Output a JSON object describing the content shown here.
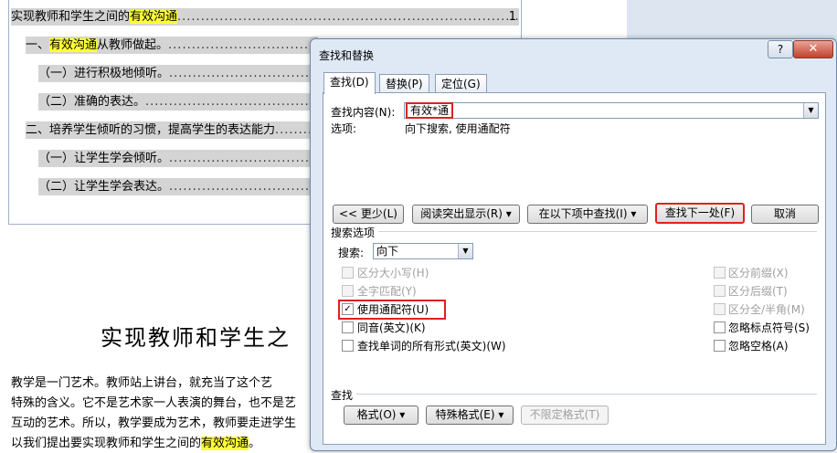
{
  "document": {
    "toc": [
      {
        "before": "实现教师和学生之间的",
        "highlight": "有效沟通",
        "after": "",
        "dots": "..................................................................................................................",
        "page": "1"
      },
      {
        "before": "一、",
        "highlight": "有效沟通",
        "after": "从教师做起。",
        "dots": "............................................................................."
      },
      {
        "before": "（一）进行积极地倾听。",
        "highlight": "",
        "after": "",
        "dots": "............................................................................."
      },
      {
        "before": "（二）准确的表达。",
        "highlight": "",
        "after": "",
        "dots": "..................................................................................."
      },
      {
        "before": "二、培养学生倾听的习惯，提高学生的表达能力",
        "highlight": "",
        "after": "",
        "dots": "..............."
      },
      {
        "before": "（一）让学生学会倾听。",
        "highlight": "",
        "after": "",
        "dots": "............................................................................."
      },
      {
        "before": "（二）让学生学会表达。",
        "highlight": "",
        "after": "",
        "dots": "............................................................................."
      }
    ],
    "title": "实现教师和学生之",
    "paragraph": [
      {
        "text": "    教学是一门艺术。教师站上讲台，就充当了这个艺",
        "highlight": ""
      },
      {
        "text": "特殊的含义。它不是艺术家一人表演的舞台，也不是艺",
        "highlight": ""
      },
      {
        "text": "互动的艺术。所以，教学要成为艺术，教师要走进学生",
        "highlight": ""
      },
      {
        "text": "以我们提出要实现教师和学生之间的",
        "highlight": "有效沟通",
        "tail": "。"
      }
    ]
  },
  "dialog": {
    "title": "查找和替换",
    "help_label": "?",
    "close_label": "✕",
    "tabs": [
      "查找(D)",
      "替换(P)",
      "定位(G)"
    ],
    "find_label": "查找内容(N):",
    "find_value": "有效*通",
    "options_label": "选项:",
    "options_value": "向下搜索, 使用通配符",
    "buttons": {
      "less": "<< 更少(L)",
      "reading_highlight": "阅读突出显示(R) ▾",
      "find_in": "在以下项中查找(I) ▾",
      "find_next": "查找下一处(F)",
      "cancel": "取消"
    },
    "search_options_title": "搜索选项",
    "search_label": "搜索:",
    "search_direction": "向下",
    "checkboxes_left": [
      {
        "label": "区分大小写(H)",
        "checked": false,
        "enabled": false
      },
      {
        "label": "全字匹配(Y)",
        "checked": false,
        "enabled": false
      },
      {
        "label": "使用通配符(U)",
        "checked": true,
        "enabled": true
      },
      {
        "label": "同音(英文)(K)",
        "checked": false,
        "enabled": true
      },
      {
        "label": "查找单词的所有形式(英文)(W)",
        "checked": false,
        "enabled": true
      }
    ],
    "checkboxes_right": [
      {
        "label": "区分前缀(X)",
        "checked": false,
        "enabled": false
      },
      {
        "label": "区分后缀(T)",
        "checked": false,
        "enabled": false
      },
      {
        "label": "区分全/半角(M)",
        "checked": false,
        "enabled": false
      },
      {
        "label": "忽略标点符号(S)",
        "checked": false,
        "enabled": true
      },
      {
        "label": "忽略空格(A)",
        "checked": false,
        "enabled": true
      }
    ],
    "find_section_title": "查找",
    "format_button": "格式(O) ▾",
    "special_button": "特殊格式(E) ▾",
    "no_format_button": "不限定格式(T)"
  },
  "colors": {
    "highlight": "#ffff33",
    "focus_outline": "#e02020",
    "dialog_bg": "#dfe9f5"
  }
}
